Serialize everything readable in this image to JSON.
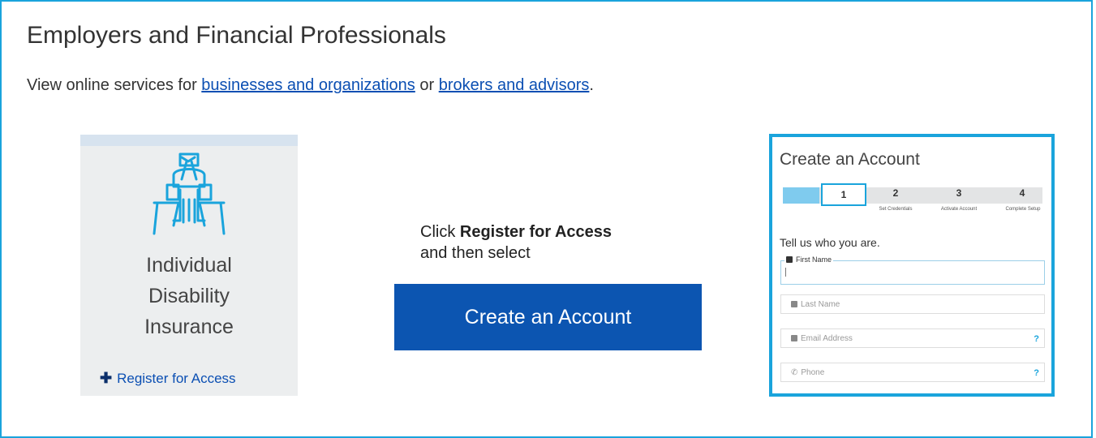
{
  "page": {
    "title": "Employers and Financial Professionals",
    "intro_prefix": "View online services for ",
    "link_businesses": "businesses and organizations",
    "intro_middle": " or ",
    "link_brokers": "brokers and advisors",
    "intro_suffix": "."
  },
  "tile": {
    "line1": "Individual",
    "line2": "Disability",
    "line3": "Insurance",
    "register_label": "Register for Access",
    "icon": "person-in-chair-icon"
  },
  "instruction": {
    "prefix": "Click ",
    "bold": "Register for Access",
    "line2": "and then select",
    "button_label": "Create an Account"
  },
  "form": {
    "title": "Create an Account",
    "steps": [
      {
        "num": "1",
        "label": ""
      },
      {
        "num": "2",
        "label": "Set Credentials"
      },
      {
        "num": "3",
        "label": "Activate Account"
      },
      {
        "num": "4",
        "label": "Complete Setup"
      }
    ],
    "prompt": "Tell us who you are.",
    "fields": {
      "first_name": "First Name",
      "last_name": "Last Name",
      "email": "Email Address",
      "phone": "Phone"
    },
    "help_mark": "?"
  },
  "colors": {
    "accent": "#1aa4dc",
    "link": "#0b4fb3",
    "button": "#0c55b1"
  }
}
